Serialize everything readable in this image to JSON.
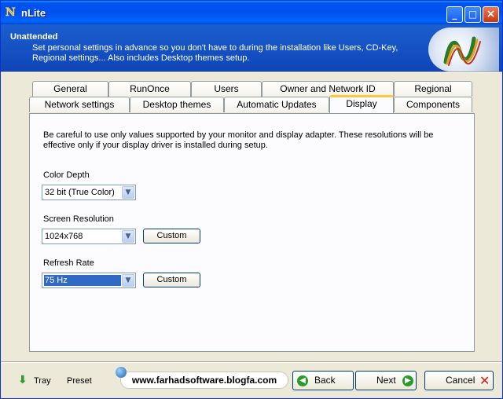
{
  "window": {
    "title": "nLite"
  },
  "header": {
    "title": "Unattended",
    "description": "Set personal settings in advance so you don't have to during the installation like Users, CD-Key, Regional settings... Also includes Desktop themes setup."
  },
  "tabs": {
    "row1": [
      "General",
      "RunOnce",
      "Users",
      "Owner and Network ID",
      "Regional"
    ],
    "row2": [
      "Network settings",
      "Desktop themes",
      "Automatic Updates",
      "Display",
      "Components"
    ],
    "active": "Display"
  },
  "display": {
    "notice": "Be careful to use only values supported by your monitor and display adapter. These resolutions will be effective only if your display driver is installed during setup.",
    "color_depth": {
      "label": "Color Depth",
      "value": "32 bit (True Color)"
    },
    "screen_resolution": {
      "label": "Screen Resolution",
      "value": "1024x768",
      "custom_label": "Custom"
    },
    "refresh_rate": {
      "label": "Refresh Rate",
      "value": "75 Hz",
      "custom_label": "Custom"
    }
  },
  "footer": {
    "tray_label": "Tray",
    "preset_label": "Preset",
    "url_overlay": "www.farhadsoftware.blogfa.com",
    "back_label": "Back",
    "next_label": "Next",
    "cancel_label": "Cancel"
  },
  "colors": {
    "title_bar": "#0053ee",
    "header_bg": "#1b5fcf",
    "active_tab_accent": "#ffc83c",
    "selection": "#316ac5"
  },
  "icons": [
    "nlite-icon",
    "minimize-icon",
    "maximize-icon",
    "close-icon",
    "nlite-logo",
    "tray-icon",
    "globe-icon",
    "back-arrow-icon",
    "next-arrow-icon",
    "cancel-x-icon",
    "chevron-down-icon"
  ]
}
